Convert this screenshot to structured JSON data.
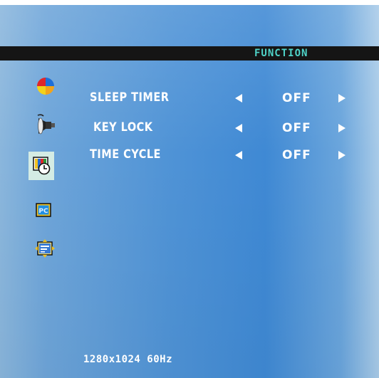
{
  "title": "FUNCTION",
  "sidebar": {
    "icons": [
      {
        "name": "color-icon"
      },
      {
        "name": "audio-icon"
      },
      {
        "name": "function-clock-icon",
        "selected": true
      },
      {
        "name": "pc-icon"
      },
      {
        "name": "position-icon"
      }
    ]
  },
  "menu": {
    "items": [
      {
        "label": "SLEEP TIMER",
        "value": "OFF"
      },
      {
        "label": "KEY LOCK",
        "value": "OFF"
      },
      {
        "label": "TIME CYCLE",
        "value": "OFF"
      }
    ]
  },
  "status": {
    "resolution": "1280x1024 60Hz"
  },
  "colors": {
    "title_text": "#4fd3c8",
    "title_bar": "#151515",
    "menu_text": "#ffffff",
    "selected_icon_bg": "#d4ece4"
  }
}
